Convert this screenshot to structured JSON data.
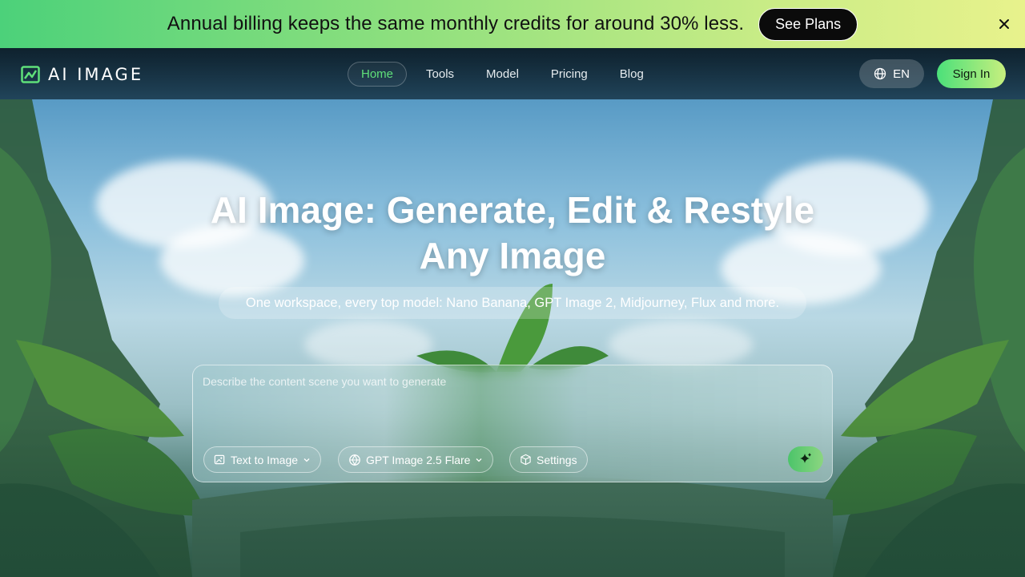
{
  "promo": {
    "text": "Annual billing keeps the same monthly credits for around 30% less.",
    "button": "See Plans",
    "close_icon": "close-icon"
  },
  "nav": {
    "logo_text": "AI IMAGE",
    "links": [
      "Home",
      "Tools",
      "Model",
      "Pricing",
      "Blog"
    ],
    "active": "Home",
    "language": "EN",
    "language_icon": "globe-icon",
    "sign_in": "Sign In"
  },
  "hero": {
    "title_line1": "AI Image: Generate, Edit & Restyle",
    "title_line2": "Any Image",
    "subtitle": "One workspace, every top model: Nano Banana, GPT Image 2, Midjourney, Flux and more."
  },
  "prompt": {
    "placeholder": "Describe the content scene you want to generate",
    "mode": "Text to Image",
    "model": "GPT Image 2.5 Flare",
    "settings": "Settings",
    "generate_icon": "sparkle-icon"
  },
  "colors": {
    "accent_green": "#5fe07a",
    "banner_start": "#4cd17a",
    "banner_end": "#e8f28c"
  }
}
